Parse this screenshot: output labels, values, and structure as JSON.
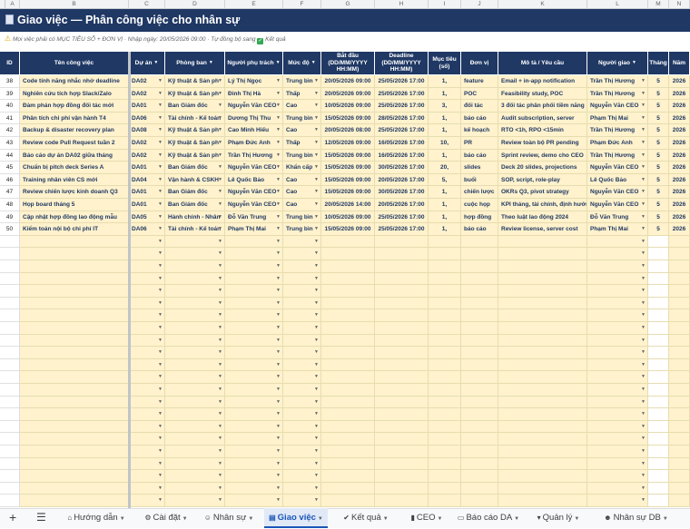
{
  "columns": [
    "A",
    "B",
    "C",
    "D",
    "E",
    "F",
    "G",
    "H",
    "I",
    "J",
    "K",
    "L",
    "M",
    "N"
  ],
  "title": "Giao việc — Phân công việc cho nhân sự",
  "note": {
    "text": "Mọi việc phải có MỤC TIÊU SỐ + ĐƠN VỊ · Nhập ngày: 20/05/2026 09:00 · Tự đồng bộ sang",
    "suffix": "Kết quả"
  },
  "headers": {
    "id": "ID",
    "ten": "Tên công việc",
    "duan": "Dự án",
    "phongban": "Phòng ban",
    "nguoi": "Người phụ trách",
    "mucdo": "Mức độ",
    "batdau": "Bắt đầu (DD/MM/YYYY HH:MM)",
    "deadline": "Deadline (DD/MM/YYYY HH:MM)",
    "muctieu": "Mục tiêu (số)",
    "donvi": "Đơn vị",
    "mota": "Mô tả / Yêu cầu",
    "nguoigiao": "Người giao",
    "thang": "Tháng",
    "nam": "Năm"
  },
  "rows": [
    {
      "id": "38",
      "ten": "Code tính năng nhắc nhở deadline",
      "duan": "DA02",
      "phongban": "Kỹ thuật & Sản ph",
      "nguoi": "Lý Thị Ngọc",
      "mucdo": "Trung bìn",
      "batdau": "20/05/2026 09:00",
      "deadline": "25/05/2026 17:00",
      "muctieu": "1,",
      "donvi": "feature",
      "mota": "Email + in-app notification",
      "nguoigiao": "Trần Thị Hương",
      "thang": "5",
      "nam": "2026"
    },
    {
      "id": "39",
      "ten": "Nghiên cứu tích hợp Slack/Zalo",
      "duan": "DA02",
      "phongban": "Kỹ thuật & Sản ph",
      "nguoi": "Đinh Thị Hà",
      "mucdo": "Thấp",
      "batdau": "20/05/2026 09:00",
      "deadline": "25/05/2026 17:00",
      "muctieu": "1,",
      "donvi": "POC",
      "mota": "Feasibility study, POC",
      "nguoigiao": "Trần Thị Hương",
      "thang": "5",
      "nam": "2026"
    },
    {
      "id": "40",
      "ten": "Đàm phán hợp đồng đối tác mới",
      "duan": "DA01",
      "phongban": "Ban Giám đốc",
      "nguoi": "Nguyễn Văn CEO",
      "mucdo": "Cao",
      "batdau": "10/05/2026 09:00",
      "deadline": "25/05/2026 17:00",
      "muctieu": "3,",
      "donvi": "đối tác",
      "mota": "3 đối tác phân phối tiềm năng",
      "nguoigiao": "Nguyễn Văn CEO",
      "thang": "5",
      "nam": "2026"
    },
    {
      "id": "41",
      "ten": "Phân tích chi phí vận hành T4",
      "duan": "DA06",
      "phongban": "Tài chính - Kế toán",
      "nguoi": "Dương Thị Thu",
      "mucdo": "Trung bìn",
      "batdau": "15/05/2026 09:00",
      "deadline": "28/05/2026 17:00",
      "muctieu": "1,",
      "donvi": "báo cáo",
      "mota": "Audit subscription, server",
      "nguoigiao": "Phạm Thị Mai",
      "thang": "5",
      "nam": "2026"
    },
    {
      "id": "42",
      "ten": "Backup & disaster recovery plan",
      "duan": "DA08",
      "phongban": "Kỹ thuật & Sản ph",
      "nguoi": "Cao Minh Hiếu",
      "mucdo": "Cao",
      "batdau": "20/05/2026 08:00",
      "deadline": "25/05/2026 17:00",
      "muctieu": "1,",
      "donvi": "kế hoạch",
      "mota": "RTO <1h, RPO <15min",
      "nguoigiao": "Trần Thị Hương",
      "thang": "5",
      "nam": "2026"
    },
    {
      "id": "43",
      "ten": "Review code Pull Request tuần 2",
      "duan": "DA02",
      "phongban": "Kỹ thuật & Sản ph",
      "nguoi": "Phạm Đức Anh",
      "mucdo": "Thấp",
      "batdau": "12/05/2026 09:00",
      "deadline": "16/05/2026 17:00",
      "muctieu": "10,",
      "donvi": "PR",
      "mota": "Review toàn bộ PR pending",
      "nguoigiao": "Phạm Đức Anh",
      "thang": "5",
      "nam": "2026"
    },
    {
      "id": "44",
      "ten": "Báo cáo dự án DA02 giữa tháng",
      "duan": "DA02",
      "phongban": "Kỹ thuật & Sản ph",
      "nguoi": "Trần Thị Hương",
      "mucdo": "Trung bìn",
      "batdau": "15/05/2026 09:00",
      "deadline": "16/05/2026 17:00",
      "muctieu": "1,",
      "donvi": "báo cáo",
      "mota": "Sprint review, demo cho CEO",
      "nguoigiao": "Trần Thị Hương",
      "thang": "5",
      "nam": "2026"
    },
    {
      "id": "45",
      "ten": "Chuẩn bị pitch deck Series A",
      "duan": "DA01",
      "phongban": "Ban Giám đốc",
      "nguoi": "Nguyễn Văn CEO",
      "mucdo": "Khẩn cấp",
      "batdau": "15/05/2026 09:00",
      "deadline": "30/05/2026 17:00",
      "muctieu": "20,",
      "donvi": "slides",
      "mota": "Deck 20 slides, projections",
      "nguoigiao": "Nguyễn Văn CEO",
      "thang": "5",
      "nam": "2026"
    },
    {
      "id": "46",
      "ten": "Training nhân viên CS mới",
      "duan": "DA04",
      "phongban": "Vận hành & CSKH",
      "nguoi": "Lê Quốc Bảo",
      "mucdo": "Cao",
      "batdau": "15/05/2026 09:00",
      "deadline": "20/05/2026 17:00",
      "muctieu": "5,",
      "donvi": "buổi",
      "mota": "SOP, script, role-play",
      "nguoigiao": "Lê Quốc Bảo",
      "thang": "5",
      "nam": "2026"
    },
    {
      "id": "47",
      "ten": "Review chiến lược kinh doanh Q3",
      "duan": "DA01",
      "phongban": "Ban Giám đốc",
      "nguoi": "Nguyễn Văn CEO",
      "mucdo": "Cao",
      "batdau": "15/05/2026 09:00",
      "deadline": "30/05/2026 17:00",
      "muctieu": "1,",
      "donvi": "chiến lược",
      "mota": "OKRs Q3, pivot strategy",
      "nguoigiao": "Nguyễn Văn CEO",
      "thang": "5",
      "nam": "2026"
    },
    {
      "id": "48",
      "ten": "Họp board tháng 5",
      "duan": "DA01",
      "phongban": "Ban Giám đốc",
      "nguoi": "Nguyễn Văn CEO",
      "mucdo": "Cao",
      "batdau": "20/05/2026 14:00",
      "deadline": "20/05/2026 17:00",
      "muctieu": "1,",
      "donvi": "cuộc họp",
      "mota": "KPI tháng, tài chính, định hướng",
      "nguoigiao": "Nguyễn Văn CEO",
      "thang": "5",
      "nam": "2026"
    },
    {
      "id": "49",
      "ten": "Cập nhật hợp đồng lao động mẫu",
      "duan": "DA05",
      "phongban": "Hành chính - Nhân",
      "nguoi": "Đỗ Văn Trung",
      "mucdo": "Trung bìn",
      "batdau": "10/05/2026 09:00",
      "deadline": "25/05/2026 17:00",
      "muctieu": "1,",
      "donvi": "hợp đồng",
      "mota": "Theo luật lao động 2024",
      "nguoigiao": "Đỗ Văn Trung",
      "thang": "5",
      "nam": "2026"
    },
    {
      "id": "50",
      "ten": "Kiểm toán nội bộ chi phí IT",
      "duan": "DA06",
      "phongban": "Tài chính - Kế toán",
      "nguoi": "Phạm Thị Mai",
      "mucdo": "Trung bìn",
      "batdau": "15/05/2026 09:00",
      "deadline": "25/05/2026 17:00",
      "muctieu": "1,",
      "donvi": "báo cáo",
      "mota": "Review license, server cost",
      "nguoigiao": "Phạm Thị Mai",
      "thang": "5",
      "nam": "2026"
    }
  ],
  "tabs": [
    {
      "label": "Hướng dẫn",
      "icon": "house-icon"
    },
    {
      "label": "Cài đặt",
      "icon": "gear-icon"
    },
    {
      "label": "Nhân sự",
      "icon": "person-icon"
    },
    {
      "label": "Giao việc",
      "icon": "document-icon",
      "active": true
    },
    {
      "label": "Kết quả",
      "icon": "check-icon"
    },
    {
      "label": "CEO",
      "icon": "chart-icon"
    },
    {
      "label": "Báo cáo DA",
      "icon": "folder-icon"
    },
    {
      "label": "Quản lý",
      "icon": "chart-down-icon"
    },
    {
      "label": "Nhân sự DB",
      "icon": "people-icon"
    }
  ],
  "colors": {
    "header": "#1f3864",
    "cell_fill": "#fff2cc",
    "active_tab": "#1a56b8"
  }
}
